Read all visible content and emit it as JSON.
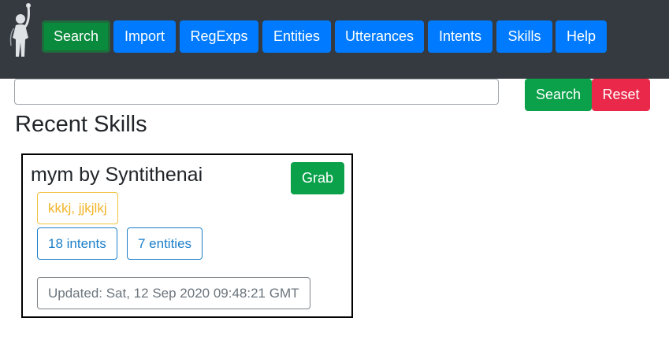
{
  "nav": {
    "items": [
      {
        "label": "Search",
        "active": true
      },
      {
        "label": "Import"
      },
      {
        "label": "RegExps"
      },
      {
        "label": "Entities"
      },
      {
        "label": "Utterances"
      },
      {
        "label": "Intents"
      },
      {
        "label": "Skills"
      },
      {
        "label": "Help"
      }
    ]
  },
  "logo": {
    "icon": "person-with-microphone-icon"
  },
  "search": {
    "value": "",
    "placeholder": "",
    "search_label": "Search",
    "reset_label": "Reset"
  },
  "page": {
    "title": "Recent Skills"
  },
  "skills": [
    {
      "title": "mym by Syntithenai",
      "grab_label": "Grab",
      "tags": "kkkj, jjkjlkj",
      "intents": "18 intents",
      "entities": "7 entities",
      "updated": "Updated: Sat, 12 Sep 2020 09:48:21 GMT"
    }
  ],
  "colors": {
    "navbar_bg": "#343a40",
    "primary": "#007bff",
    "success": "#0aa14a",
    "danger": "#e9284a",
    "warning": "#f0b429",
    "info": "#1d7fc9"
  }
}
